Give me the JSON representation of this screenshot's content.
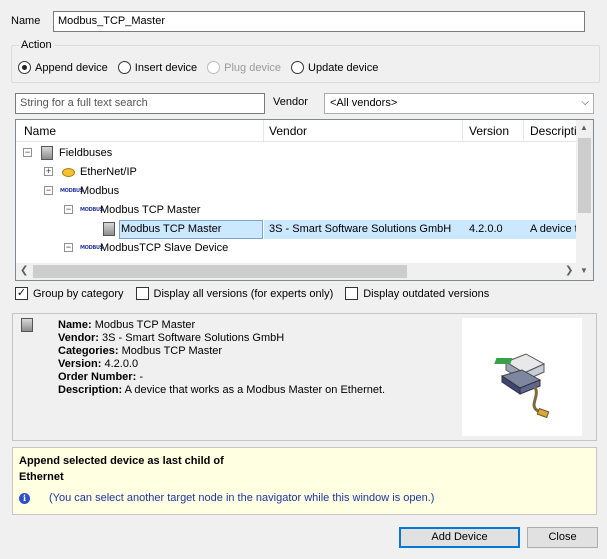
{
  "name": {
    "label": "Name",
    "value": "Modbus_TCP_Master"
  },
  "action": {
    "legend": "Action",
    "options": [
      {
        "label": "Append device",
        "checked": true,
        "disabled": false
      },
      {
        "label": "Insert device",
        "checked": false,
        "disabled": false
      },
      {
        "label": "Plug device",
        "checked": false,
        "disabled": true
      },
      {
        "label": "Update device",
        "checked": false,
        "disabled": false
      }
    ]
  },
  "filter": {
    "search_placeholder": "String for a full text search",
    "vendor_label": "Vendor",
    "vendor_value": "<All vendors>"
  },
  "tree": {
    "columns": [
      "Name",
      "Vendor",
      "Version",
      "Descriptio"
    ],
    "rows": [
      {
        "name": "Fieldbuses",
        "vendor": "",
        "version": "",
        "description": "",
        "expander": "−",
        "icon": "device-icon"
      },
      {
        "name": "EtherNet/IP",
        "vendor": "",
        "version": "",
        "description": "",
        "expander": "+",
        "icon": "ethernet-ip-icon"
      },
      {
        "name": "Modbus",
        "vendor": "",
        "version": "",
        "description": "",
        "expander": "−",
        "icon": "modbus-icon",
        "icon_text": "MODBUS"
      },
      {
        "name": "Modbus TCP Master",
        "vendor": "",
        "version": "",
        "description": "",
        "expander": "−",
        "icon": "modbus-icon",
        "icon_text": "MODBUS"
      },
      {
        "name": "Modbus TCP Master",
        "vendor": "3S - Smart Software Solutions GmbH",
        "version": "4.2.0.0",
        "description": "A device t",
        "expander": "",
        "icon": "device-icon",
        "selected": true
      },
      {
        "name": "ModbusTCP Slave Device",
        "vendor": "",
        "version": "",
        "description": "",
        "expander": "−",
        "icon": "modbus-icon",
        "icon_text": "MODBUS"
      }
    ]
  },
  "options": [
    {
      "label": "Group by category",
      "checked": true
    },
    {
      "label": "Display all versions (for experts only)",
      "checked": false
    },
    {
      "label": "Display outdated versions",
      "checked": false
    }
  ],
  "details": {
    "name_label": "Name:",
    "name_value": "Modbus TCP Master",
    "vendor_label": "Vendor:",
    "vendor_value": "3S - Smart Software Solutions GmbH",
    "categories_label": "Categories:",
    "categories_value": "Modbus TCP Master",
    "version_label": "Version:",
    "version_value": "4.2.0.0",
    "order_label": "Order Number:",
    "order_value": "-",
    "description_label": "Description:",
    "description_value": "A device that works as a Modbus Master on Ethernet."
  },
  "hint": {
    "line1": "Append selected device as last child of",
    "line2": "Ethernet",
    "info": "(You can select another target node in the navigator while this window is open.)"
  },
  "buttons": {
    "add_device": "Add Device",
    "close": "Close"
  },
  "icon_texts": {
    "info": "i"
  }
}
